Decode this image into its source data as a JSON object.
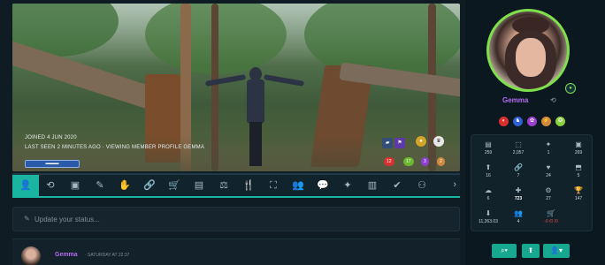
{
  "banner": {
    "joined": "JOINED 4 JUN 2020",
    "last_seen": "LAST SEEN 2 MINUTES AGO · VIEWING MEMBER PROFILE GEMMA",
    "progress_badge": "▬▬▬",
    "pills": [
      "12",
      "17",
      "3",
      "2"
    ]
  },
  "nav": {
    "icons": [
      "user-icon",
      "history-icon",
      "chat-icon",
      "edit-icon",
      "hand-icon",
      "link-icon",
      "cart-icon",
      "gallery-icon",
      "gym-icon",
      "food-icon",
      "network-icon",
      "group-icon",
      "comment-icon",
      "sparkle-icon",
      "card-icon",
      "check-icon",
      "award-icon",
      "more-icon"
    ],
    "glyphs": [
      "👤",
      "⟲",
      "▣",
      "✎",
      "✋",
      "🔗",
      "🛒",
      "▤",
      "⚖",
      "🍴",
      "⛶",
      "👥",
      "💬",
      "✦",
      "▥",
      "✔",
      "⚇",
      "⋯"
    ]
  },
  "status": {
    "placeholder": "Update your status..."
  },
  "post": {
    "author": "Gemma",
    "meta": "· SATURDAY AT 22:37"
  },
  "profile": {
    "username": "Gemma"
  },
  "stats": [
    {
      "icon": "▤",
      "value": "259"
    },
    {
      "icon": "⬚",
      "value": "2,057"
    },
    {
      "icon": "✦",
      "value": "1"
    },
    {
      "icon": "▣",
      "value": "269"
    },
    {
      "icon": "⬆",
      "value": "16"
    },
    {
      "icon": "🔗",
      "value": "7"
    },
    {
      "icon": "♥",
      "value": "24"
    },
    {
      "icon": "⬒",
      "value": "5"
    },
    {
      "icon": "☁",
      "value": "6"
    },
    {
      "icon": "✚",
      "value": "723"
    },
    {
      "icon": "⚙",
      "value": "27"
    },
    {
      "icon": "🏆",
      "value": "147"
    },
    {
      "icon": "⬇",
      "value": "11,263.03"
    },
    {
      "icon": "👥",
      "value": "4"
    },
    {
      "icon": "🛒",
      "value": "-0 /0 /0"
    }
  ],
  "colors": {
    "accent": "#19b5a0",
    "username": "#b66cf0",
    "online_ring": "#7ee04a"
  }
}
